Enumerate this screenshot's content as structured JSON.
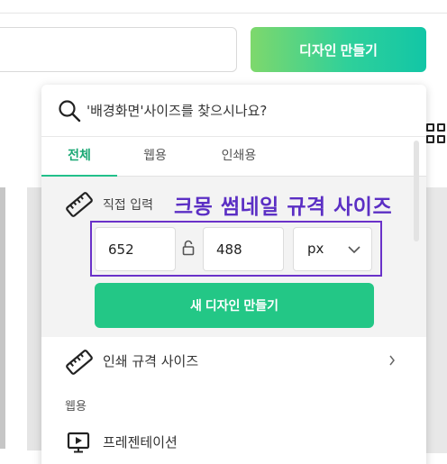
{
  "header": {
    "create_button_label": "디자인 만들기"
  },
  "dropdown": {
    "search": {
      "placeholder": "'배경화면'사이즈를 찾으시나요?"
    },
    "tabs": [
      {
        "label": "전체",
        "active": true
      },
      {
        "label": "웹용",
        "active": false
      },
      {
        "label": "인쇄용",
        "active": false
      }
    ],
    "custom_size": {
      "label": "직접 입력",
      "width": "652",
      "height": "488",
      "unit": "px",
      "create_button_label": "새 디자인 만들기"
    },
    "print_sizes_label": "인쇄 규격 사이즈",
    "web_section_label": "웹용",
    "web_items": [
      {
        "label": "프레젠테이션",
        "icon": "presentation-icon"
      }
    ]
  },
  "annotation": {
    "text": "크몽 썸네일 규격 사이즈",
    "color": "#5b2fc4"
  },
  "colors": {
    "accent": "#23c786",
    "active_tab": "#1aa874"
  }
}
